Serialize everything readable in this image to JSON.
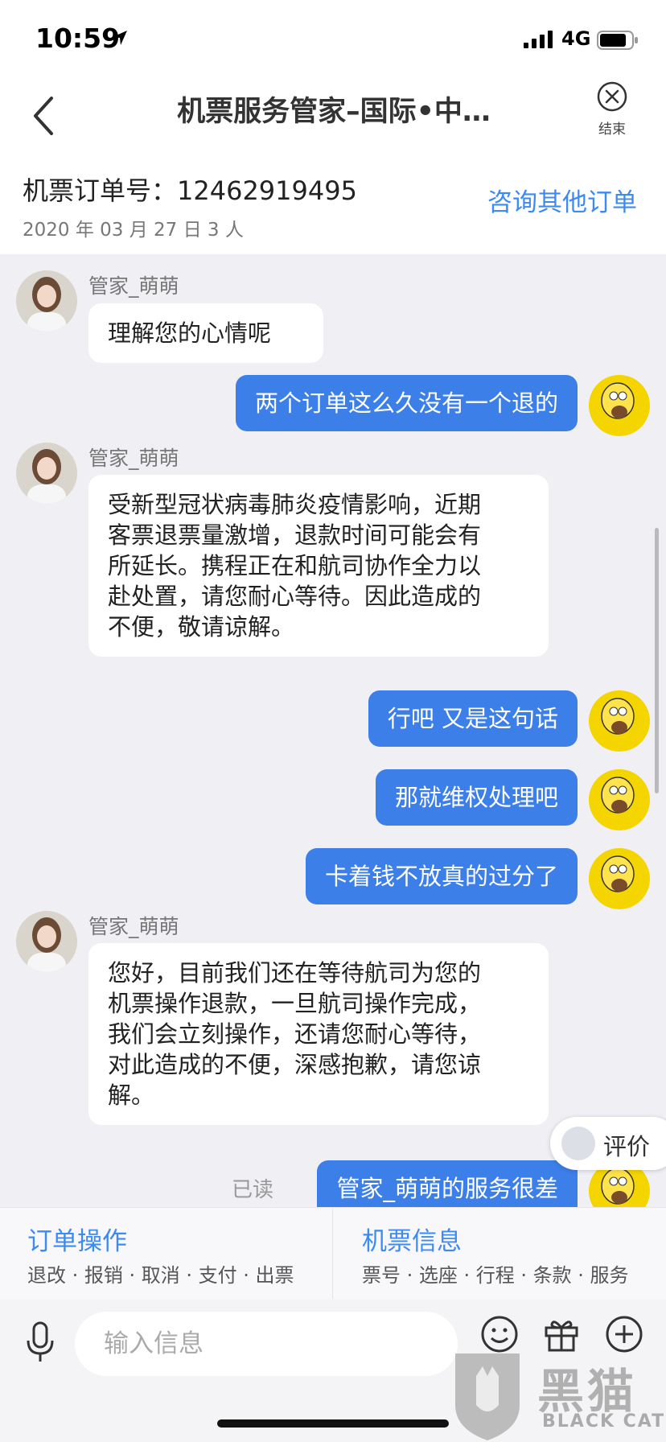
{
  "status_bar": {
    "time": "10:59",
    "network": "4G"
  },
  "nav": {
    "title": "机票服务管家–国际•中…",
    "end_label": "结束"
  },
  "order": {
    "number_text": "机票订单号：12462919495",
    "meta": "2020 年 03 月 27 日  3 人",
    "other_orders_link": "咨询其他订单"
  },
  "messages": [
    {
      "from": "agent",
      "sender": "管家_萌萌",
      "text": "理解您的心情呢"
    },
    {
      "from": "user",
      "text": "两个订单这么久没有一个退的"
    },
    {
      "from": "agent",
      "sender": "管家_萌萌",
      "lines": [
        "受新型冠状病毒肺炎疫情影响，近期",
        "客票退票量激增，退款时间可能会有",
        "所延长。携程正在和航司协作全力以",
        "赴处置，请您耐心等待。因此造成的",
        "不便，敬请谅解。"
      ]
    },
    {
      "from": "user",
      "text": "行吧 又是这句话"
    },
    {
      "from": "user",
      "text": "那就维权处理吧"
    },
    {
      "from": "user",
      "text": "卡着钱不放真的过分了"
    },
    {
      "from": "agent",
      "sender": "管家_萌萌",
      "lines": [
        "您好，目前我们还在等待航司为您的",
        "机票操作退款，一旦航司操作完成，",
        "我们会立刻操作，还请您耐心等待，",
        "对此造成的不便，深感抱歉，请您谅",
        "解。"
      ]
    },
    {
      "from": "user",
      "text": "管家_萌萌的服务很差",
      "status": "已读"
    }
  ],
  "rate_button": {
    "label": "评价"
  },
  "quick_panel": {
    "order_ops": {
      "title": "订单操作",
      "subtitle": "退改 · 报销 · 取消 · 支付 · 出票"
    },
    "ticket_info": {
      "title": "机票信息",
      "subtitle": "票号 · 选座 · 行程 · 条款 · 服务"
    }
  },
  "input": {
    "placeholder": "输入信息"
  },
  "icons": [
    "location-arrow-icon",
    "signal-icon",
    "battery-icon",
    "back-chevron-icon",
    "close-circle-icon",
    "microphone-icon",
    "emoji-icon",
    "gift-icon",
    "plus-circle-icon"
  ],
  "watermark": {
    "cn": "黑猫",
    "en": "BLACK CAT"
  },
  "colors": {
    "accent": "#3d7fe8",
    "link": "#3d8bf2",
    "chat_bg": "#efeff4"
  }
}
